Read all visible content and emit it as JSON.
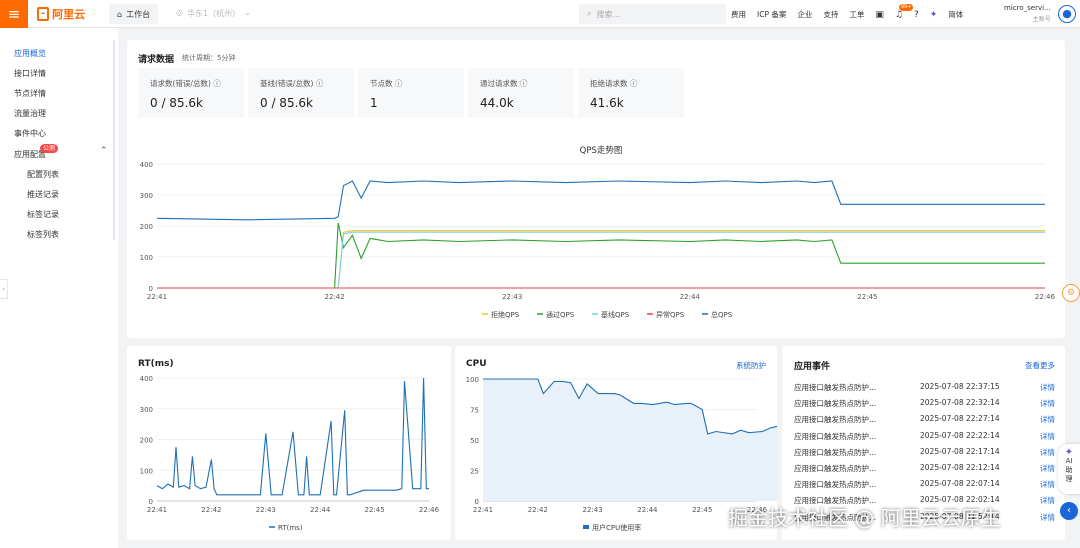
{
  "topbar": {
    "logo_text": "阿里云",
    "workbench": "工作台",
    "region": "华东1（杭州）",
    "search_placeholder": "搜索...",
    "nav": [
      "费用",
      "ICP 备案",
      "企业",
      "支持",
      "工单"
    ],
    "notify_badge": "99+",
    "lang": "简体",
    "account_name": "micro_servi...",
    "account_role": "主账号"
  },
  "sidebar": {
    "items": [
      "应用概览",
      "接口详情",
      "节点详情",
      "流量治理",
      "事件中心",
      "应用配置"
    ],
    "beta_badge": "公测",
    "subitems": [
      "配置列表",
      "推送记录",
      "标签记录",
      "标签列表"
    ]
  },
  "request": {
    "title": "请求数据",
    "period": "统计周期：5分钟",
    "stats": [
      {
        "label": "请求数(错误/总数)",
        "value": "0 / 85.6k"
      },
      {
        "label": "基线(错误/总数)",
        "value": "0 / 85.6k"
      },
      {
        "label": "节点数",
        "value": "1"
      },
      {
        "label": "通过请求数",
        "value": "44.0k"
      },
      {
        "label": "拒绝请求数",
        "value": "41.6k"
      }
    ]
  },
  "rt": {
    "title": "RT(ms)",
    "legend": "RT(ms)"
  },
  "cpu": {
    "title": "CPU",
    "link": "系统防护",
    "legend": "用户CPU使用率"
  },
  "events": {
    "title": "应用事件",
    "more": "查看更多",
    "rows": [
      {
        "name": "应用接口触发热点防护...",
        "time": "2025-07-08 22:37:15",
        "action": "详情"
      },
      {
        "name": "应用接口触发热点防护...",
        "time": "2025-07-08 22:32:14",
        "action": "详情"
      },
      {
        "name": "应用接口触发热点防护...",
        "time": "2025-07-08 22:27:14",
        "action": "详情"
      },
      {
        "name": "应用接口触发热点防护...",
        "time": "2025-07-08 22:22:14",
        "action": "详情"
      },
      {
        "name": "应用接口触发热点防护...",
        "time": "2025-07-08 22:17:14",
        "action": "详情"
      },
      {
        "name": "应用接口触发热点防护...",
        "time": "2025-07-08 22:12:14",
        "action": "详情"
      },
      {
        "name": "应用接口触发热点防护...",
        "time": "2025-07-08 22:07:14",
        "action": "详情"
      },
      {
        "name": "应用接口触发热点防护...",
        "time": "2025-07-08 22:02:14",
        "action": "详情"
      },
      {
        "name": "应用接口触发热点防护...",
        "time": "2025-07-08 21:52:14",
        "action": "详情"
      }
    ]
  },
  "overlay": {
    "watermark": "掘金技术社区 @ 阿里云云原生",
    "ai_label_1": "AI",
    "ai_label_2": "助",
    "ai_label_3": "理"
  },
  "colors": {
    "accent": "#ff6a00",
    "link": "#1a66d8",
    "total": "#1f6fb4",
    "pass": "#2ca02c",
    "reject": "#f5c518",
    "baseline": "#7ad0e8",
    "error": "#e8453c"
  },
  "chart_data": [
    {
      "type": "line",
      "title": "QPS走势图",
      "x_ticks": [
        "22:41",
        "22:42",
        "22:43",
        "22:44",
        "22:45",
        "22:46"
      ],
      "ylim": [
        0,
        400
      ],
      "y_ticks": [
        0,
        100,
        200,
        300,
        400
      ],
      "legend_position": "bottom",
      "x": [
        0,
        0.5,
        1,
        1.02,
        1.05,
        1.1,
        1.15,
        1.2,
        1.3,
        1.5,
        1.7,
        2,
        2.3,
        2.6,
        3,
        3.2,
        3.4,
        3.6,
        3.7,
        3.8,
        3.85,
        4,
        4.5,
        5
      ],
      "series": [
        {
          "name": "拒绝QPS",
          "values": [
            0,
            0,
            0,
            0,
            180,
            185,
            185,
            185,
            185,
            185,
            185,
            185,
            185,
            185,
            185,
            185,
            185,
            185,
            185,
            185,
            185,
            185,
            185,
            185
          ]
        },
        {
          "name": "通过QPS",
          "values": [
            0,
            0,
            0,
            210,
            130,
            170,
            95,
            160,
            150,
            155,
            150,
            155,
            150,
            155,
            150,
            155,
            150,
            155,
            150,
            155,
            80,
            80,
            80,
            80
          ]
        },
        {
          "name": "基线QPS",
          "values": [
            0,
            0,
            0,
            0,
            175,
            180,
            180,
            180,
            180,
            180,
            180,
            180,
            180,
            180,
            180,
            180,
            180,
            180,
            180,
            180,
            180,
            180,
            180,
            180
          ]
        },
        {
          "name": "异常QPS",
          "values": [
            0,
            0,
            0,
            0,
            0,
            0,
            0,
            0,
            0,
            0,
            0,
            0,
            0,
            0,
            0,
            0,
            0,
            0,
            0,
            0,
            0,
            0,
            0,
            0
          ]
        },
        {
          "name": "总QPS",
          "values": [
            225,
            220,
            225,
            230,
            330,
            345,
            290,
            345,
            340,
            345,
            340,
            345,
            340,
            345,
            340,
            345,
            340,
            345,
            340,
            345,
            270,
            270,
            270,
            270
          ]
        }
      ]
    },
    {
      "type": "line",
      "title": "RT(ms)",
      "x_ticks": [
        "22:41",
        "22:42",
        "22:43",
        "22:44",
        "22:45",
        "22:46"
      ],
      "ylim": [
        0,
        400
      ],
      "y_ticks": [
        0,
        100,
        200,
        300,
        400
      ],
      "series": [
        {
          "name": "RT(ms)",
          "x": [
            0,
            0.1,
            0.2,
            0.3,
            0.35,
            0.4,
            0.5,
            0.6,
            0.65,
            0.7,
            0.8,
            0.9,
            1.0,
            1.05,
            1.1,
            1.3,
            1.5,
            1.9,
            2.0,
            2.1,
            2.3,
            2.5,
            2.6,
            2.7,
            2.75,
            2.8,
            3.0,
            3.2,
            3.25,
            3.3,
            3.45,
            3.5,
            3.55,
            3.8,
            4.4,
            4.5,
            4.55,
            4.7,
            4.85,
            4.9,
            4.95,
            5
          ],
          "values": [
            50,
            40,
            55,
            45,
            175,
            45,
            50,
            40,
            145,
            50,
            40,
            45,
            135,
            40,
            20,
            20,
            20,
            20,
            220,
            20,
            20,
            225,
            20,
            20,
            145,
            20,
            20,
            260,
            20,
            20,
            295,
            20,
            20,
            35,
            35,
            40,
            390,
            40,
            40,
            400,
            40,
            40
          ]
        }
      ]
    },
    {
      "type": "area",
      "title": "CPU",
      "x_ticks": [
        "22:41",
        "22:42",
        "22:43",
        "22:44",
        "22:45",
        "22:46"
      ],
      "ylim": [
        0,
        100
      ],
      "y_ticks": [
        0,
        25,
        50,
        75,
        100
      ],
      "series": [
        {
          "name": "用户CPU使用率",
          "x": [
            0,
            0.5,
            0.9,
            1.0,
            1.1,
            1.3,
            1.45,
            1.6,
            1.75,
            1.9,
            2.1,
            2.4,
            2.5,
            2.75,
            2.9,
            3.1,
            3.35,
            3.5,
            3.7,
            3.8,
            4.0,
            4.1,
            4.25,
            4.55,
            4.7,
            4.85,
            5.1,
            5.25,
            5.45,
            5.65,
            5.85,
            6.0
          ],
          "values": [
            100,
            100,
            100,
            100,
            88,
            98,
            98,
            97,
            84,
            96,
            88,
            88,
            87,
            80,
            80,
            79,
            81,
            79,
            80,
            80,
            75,
            55,
            57,
            55,
            58,
            56,
            57,
            60,
            62,
            60,
            62,
            65
          ]
        }
      ]
    }
  ]
}
